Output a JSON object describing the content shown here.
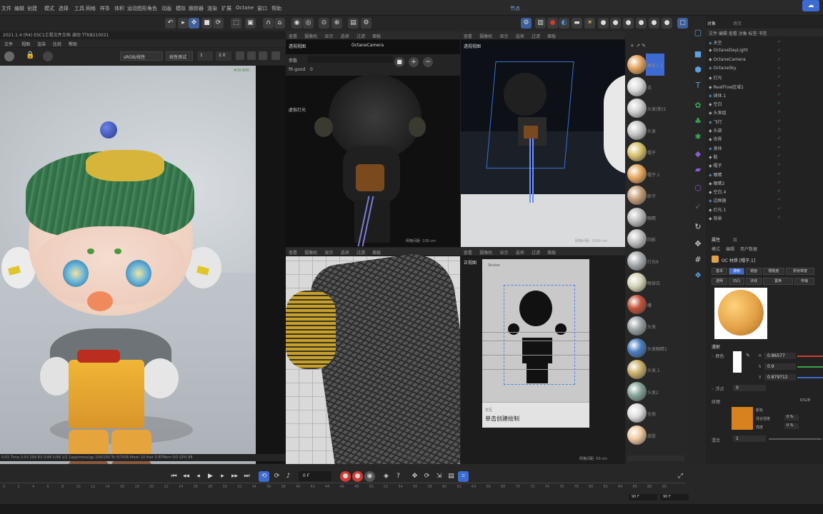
{
  "menu": [
    "文件",
    "编辑",
    "创建",
    "模式",
    "选择",
    "工具",
    "网格",
    "样条",
    "体积",
    "运动图形",
    "角色",
    "动画",
    "模拟",
    "跟踪器",
    "渲染",
    "扩展",
    "Octane",
    "窗口",
    "帮助"
  ],
  "menu_alt": "节点",
  "menu_alt2": "Octane",
  "render_window": {
    "title": "2021.1.4 (R4)  ESC1工程文件文档  调动 TTK8210021",
    "tabs": [
      "文件",
      "视图",
      "渲染",
      "比较",
      "帮助"
    ],
    "selector_left": "sRGB/线性",
    "selector_right": "线性测试",
    "zoom": "1",
    "zoom2": "2.0",
    "corner_text": "#20-800",
    "status": "0:01  Time 2:03  299 RS 0/48  5/98  1/2  1app/mess/gp  100/100  Tri 0/7936  Mesh 10  Hair 0  RTMem 0/0  GPU  88"
  },
  "vp_top_left": {
    "menus": [
      "查看",
      "摄像机",
      "显示",
      "选项",
      "过滤",
      "面板"
    ],
    "name": "透视视图",
    "camera": "OctaneCamera",
    "control_label": "参数",
    "control_value": "0",
    "control_label2": "fit-good",
    "small_label": "虚拟灯光",
    "footer": "网格间距: 100 cm"
  },
  "vp_top_right": {
    "menus": [
      "查看",
      "摄像机",
      "显示",
      "选项",
      "过滤",
      "面板"
    ],
    "name": "透视视图",
    "footer": "网格间距: 1000 cm"
  },
  "vp_bottom_left": {
    "menus": [
      "查看",
      "摄像机",
      "显示",
      "选项",
      "过滤",
      "面板"
    ],
    "footer": "网格间距: 5 cm"
  },
  "vp_bottom_right": {
    "menus": [
      "查看",
      "摄像机",
      "显示",
      "选项",
      "过滤",
      "面板"
    ],
    "name": "正视图",
    "subtitle": "Sticker",
    "footer": "网格间距: 50 cm",
    "dialog_title": "交互",
    "dialog_text": "单击创建绘制"
  },
  "materials": [
    {
      "label": "橡皮7.1",
      "color": "#e2a35e"
    },
    {
      "label": "白",
      "color": "#d8d8d8"
    },
    {
      "label": "头发(新)1",
      "color": "#cfcfcf"
    },
    {
      "label": "头发",
      "color": "#c8c8c8"
    },
    {
      "label": "帽子",
      "color": "#d8c26a"
    },
    {
      "label": "帽子.1",
      "color": "#e6a860"
    },
    {
      "label": "脸子",
      "color": "#c49e7a"
    },
    {
      "label": "眼睛",
      "color": "#bdbdbd"
    },
    {
      "label": "阴影",
      "color": "#c0c0c0"
    },
    {
      "label": "灯光6",
      "color": "#a8adb0"
    },
    {
      "label": "眼球白",
      "color": "#d6d6b8"
    },
    {
      "label": "嘴",
      "color": "#c0533c"
    },
    {
      "label": "头发",
      "color": "#9aa1a3"
    },
    {
      "label": "头发眼睛1",
      "color": "#4a7dc0"
    },
    {
      "label": "头发.1",
      "color": "#c9b06a"
    },
    {
      "label": "头发2",
      "color": "#86a39a"
    },
    {
      "label": "全局",
      "color": "#dedede"
    },
    {
      "label": "皮肤",
      "color": "#f0c9a0"
    }
  ],
  "objects": [
    "天空",
    "OctaneDayLight",
    "OctaneCamera",
    "OctaneSky",
    "灯光",
    "RealFlow区域1",
    "球体.1",
    "空白",
    "头发组",
    "飞行",
    "头部",
    "世界",
    "身体",
    "鞋",
    "帽子",
    "眼睛",
    "眼睛2",
    "空白.4",
    "边框器",
    "灯光.1",
    "背景"
  ],
  "attributes": {
    "tabs": [
      "属性",
      "层"
    ],
    "toolbar": [
      "模式",
      "编辑",
      "用户数据"
    ],
    "title": "OC 材质 [帽子.1]",
    "subtabs": [
      "基本",
      "漫射",
      "镜面",
      "粗糙度",
      "折射率度",
      "透明",
      "凹凸",
      "法线",
      "置换",
      "传输"
    ],
    "section": "漫射",
    "r": "0.86577",
    "g": "0.9",
    "b": "0.879712",
    "float": "0",
    "texture_label": "纹理",
    "texture_mode": "R/G/B",
    "sub_label": "颜色",
    "mix_label": "混合强度",
    "mix_value": "0 %",
    "bright_label": "亮度",
    "bright_value": "0 %",
    "mix2_label": "混合",
    "mix2_value": "1"
  },
  "timeline": {
    "frame": "0 F",
    "end": "90 F",
    "start": "0 F",
    "ticks": [
      "0",
      "2",
      "4",
      "6",
      "8",
      "10",
      "12",
      "14",
      "16",
      "18",
      "20",
      "22",
      "24",
      "26",
      "28",
      "30",
      "32",
      "34",
      "36",
      "38",
      "40",
      "42",
      "44",
      "46",
      "48",
      "50",
      "52",
      "54",
      "56",
      "58",
      "60",
      "62",
      "64",
      "66",
      "68",
      "70",
      "72",
      "74",
      "76",
      "78",
      "80",
      "82",
      "84",
      "86",
      "88",
      "90"
    ]
  },
  "colors": {
    "accent": "#3d6bd1",
    "green": "#38a34a",
    "red": "#d23a32"
  }
}
